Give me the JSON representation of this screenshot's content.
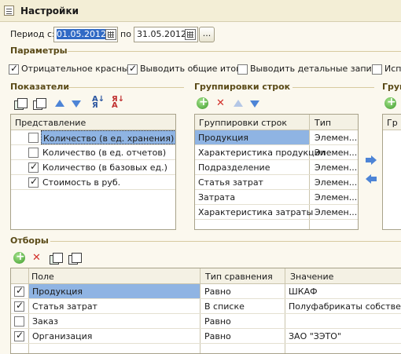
{
  "window": {
    "title": "Настройки"
  },
  "period": {
    "label_from": "Период с:",
    "from": "01.05.2012",
    "label_to": "по",
    "to": "31.05.2012",
    "more_button": "..."
  },
  "params": {
    "title": "Параметры",
    "items": [
      {
        "label": "Отрицательное красным",
        "checked": true
      },
      {
        "label": "Выводить общие итоги",
        "checked": true
      },
      {
        "label": "Выводить детальные записи",
        "checked": false
      },
      {
        "label": "Испо",
        "checked": false
      }
    ]
  },
  "indicators": {
    "title": "Показатели",
    "column": "Представление",
    "rows": [
      {
        "label": "Количество (в ед. хранения)",
        "checked": false
      },
      {
        "label": "Количество (в ед. отчетов)",
        "checked": false
      },
      {
        "label": "Количество (в базовых ед.)",
        "checked": true
      },
      {
        "label": "Стоимость в руб.",
        "checked": true
      }
    ]
  },
  "row_groups": {
    "title": "Группировки строк",
    "columns": [
      "Группировки строк",
      "Тип"
    ],
    "rows": [
      {
        "name": "Продукция",
        "type": "Элемен..."
      },
      {
        "name": "Характеристика продукции",
        "type": "Элемен..."
      },
      {
        "name": "Подразделение",
        "type": "Элемен..."
      },
      {
        "name": "Статья затрат",
        "type": "Элемен..."
      },
      {
        "name": "Затрата",
        "type": "Элемен..."
      },
      {
        "name": "Характеристика затраты",
        "type": "Элемен..."
      }
    ]
  },
  "col_groups": {
    "title": "Груп",
    "column": "Гр"
  },
  "filters": {
    "title": "Отборы",
    "columns": [
      "Поле",
      "Тип сравнения",
      "Значение"
    ],
    "rows": [
      {
        "checked": true,
        "field": "Продукция",
        "compare": "Равно",
        "value": "ШКАФ"
      },
      {
        "checked": true,
        "field": "Статья затрат",
        "compare": "В списке",
        "value": "Полуфабрикаты собствен.из"
      },
      {
        "checked": false,
        "field": "Заказ",
        "compare": "Равно",
        "value": ""
      },
      {
        "checked": true,
        "field": "Организация",
        "compare": "Равно",
        "value": "ЗАО \"ЗЭТО\""
      }
    ]
  },
  "colors": {
    "accent": "#316ac5",
    "selection": "#8fb4e3",
    "section_title": "#5a4a17",
    "background": "#fbf8ee"
  }
}
